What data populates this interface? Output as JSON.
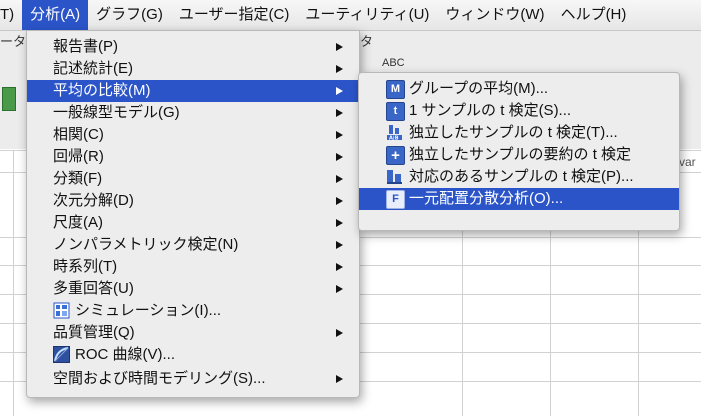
{
  "menubar": {
    "items": [
      {
        "label": "T)"
      },
      {
        "label": "分析(A)"
      },
      {
        "label": "グラフ(G)"
      },
      {
        "label": "ユーザー指定(C)"
      },
      {
        "label": "ユーティリティ(U)"
      },
      {
        "label": "ウィンドウ(W)"
      },
      {
        "label": "ヘルプ(H)"
      }
    ]
  },
  "background": {
    "toolbar_left_text": "ータ",
    "toolbar_mid_text": "タ",
    "toolbar_sub_text": "ABC",
    "col_var": "var"
  },
  "analysis_menu": {
    "items": [
      {
        "label": "報告書(P)"
      },
      {
        "label": "記述統計(E)"
      },
      {
        "label": "平均の比較(M)"
      },
      {
        "label": "一般線型モデル(G)"
      },
      {
        "label": "相関(C)"
      },
      {
        "label": "回帰(R)"
      },
      {
        "label": "分類(F)"
      },
      {
        "label": "次元分解(D)"
      },
      {
        "label": "尺度(A)"
      },
      {
        "label": "ノンパラメトリック検定(N)"
      },
      {
        "label": "時系列(T)"
      },
      {
        "label": "多重回答(U)"
      },
      {
        "label": "シミュレーション(I)..."
      },
      {
        "label": "品質管理(Q)"
      },
      {
        "label": "ROC 曲線(V)..."
      },
      {
        "label": "空間および時間モデリング(S)..."
      }
    ]
  },
  "compare_means_submenu": {
    "items": [
      {
        "label": "グループの平均(M)...",
        "icon": "M"
      },
      {
        "label": "1 サンプルの t 検定(S)...",
        "icon": "t"
      },
      {
        "label": "独立したサンプルの t 検定(T)...",
        "icon": "A|B"
      },
      {
        "label": "独立したサンプルの要約の t 検定",
        "icon": "+"
      },
      {
        "label": "対応のあるサンプルの t 検定(P)...",
        "icon": "pair"
      },
      {
        "label": "一元配置分散分析(O)...",
        "icon": "F"
      }
    ]
  },
  "colors": {
    "highlight": "#2a54c8",
    "menu_bg": "#ededed"
  }
}
